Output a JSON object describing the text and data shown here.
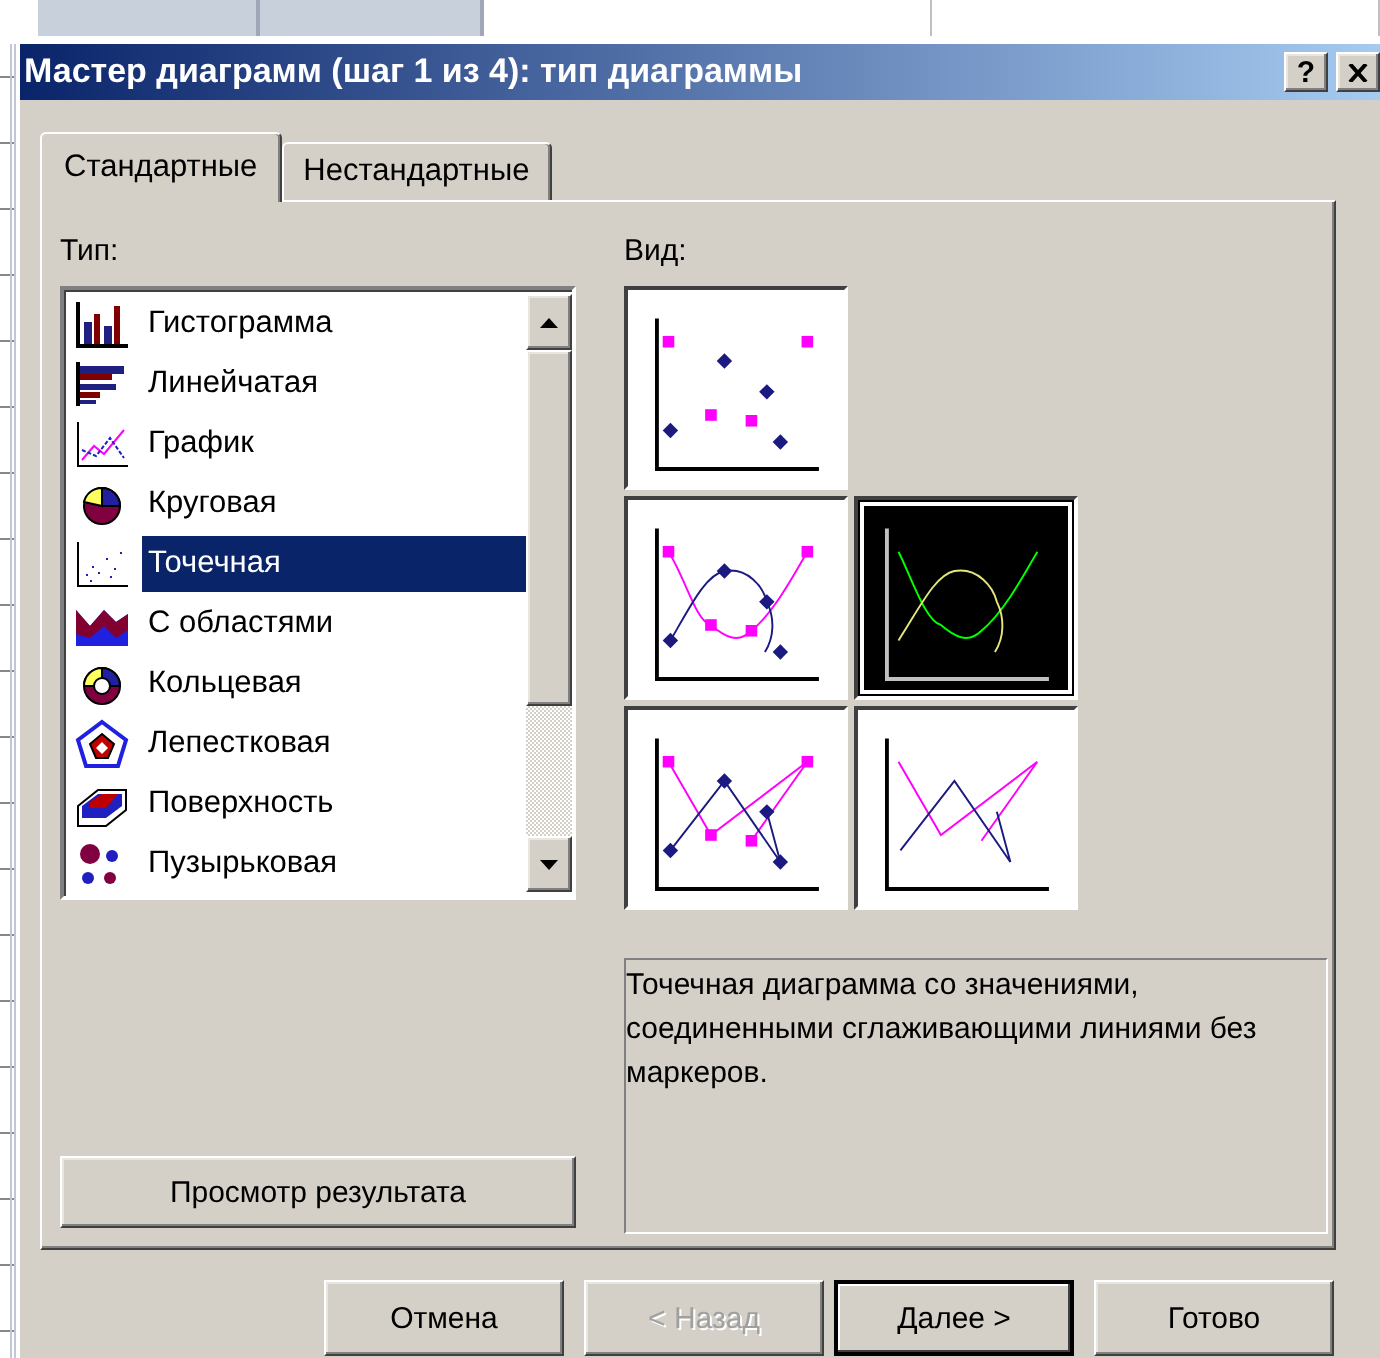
{
  "window": {
    "title": "Мастер диаграмм (шаг 1 из 4): тип диаграммы",
    "help_button": "?"
  },
  "tabs": [
    {
      "label": "Стандартные",
      "selected": true
    },
    {
      "label": "Нестандартные",
      "selected": false
    }
  ],
  "type_label": "Тип:",
  "chart_types": [
    {
      "kind": "column",
      "label": "Гистограмма",
      "selected": false
    },
    {
      "kind": "bar",
      "label": "Линейчатая",
      "selected": false
    },
    {
      "kind": "line",
      "label": "График",
      "selected": false
    },
    {
      "kind": "pie",
      "label": "Круговая",
      "selected": false
    },
    {
      "kind": "scatter",
      "label": "Точечная",
      "selected": true
    },
    {
      "kind": "area",
      "label": "С областями",
      "selected": false
    },
    {
      "kind": "doughnut",
      "label": "Кольцевая",
      "selected": false
    },
    {
      "kind": "radar",
      "label": "Лепестковая",
      "selected": false
    },
    {
      "kind": "surface",
      "label": "Поверхность",
      "selected": false
    },
    {
      "kind": "bubble",
      "label": "Пузырьковая",
      "selected": false
    }
  ],
  "view_label": "Вид:",
  "subtypes": [
    {
      "kind": "markers",
      "selected": false
    },
    {
      "kind": "smooth-markers",
      "selected": false
    },
    {
      "kind": "smooth",
      "selected": true
    },
    {
      "kind": "lines-markers",
      "selected": false
    },
    {
      "kind": "lines",
      "selected": false
    }
  ],
  "description": "Точечная диаграмма со значениями, соединенными сглаживающими линиями без маркеров.",
  "preview_button": "Просмотр результата",
  "buttons": [
    {
      "label": "Отмена",
      "disabled": false,
      "default": false
    },
    {
      "label": "< Назад",
      "disabled": true,
      "default": false
    },
    {
      "label": "Далее >",
      "disabled": false,
      "default": true
    },
    {
      "label": "Готово",
      "disabled": false,
      "default": false
    }
  ]
}
